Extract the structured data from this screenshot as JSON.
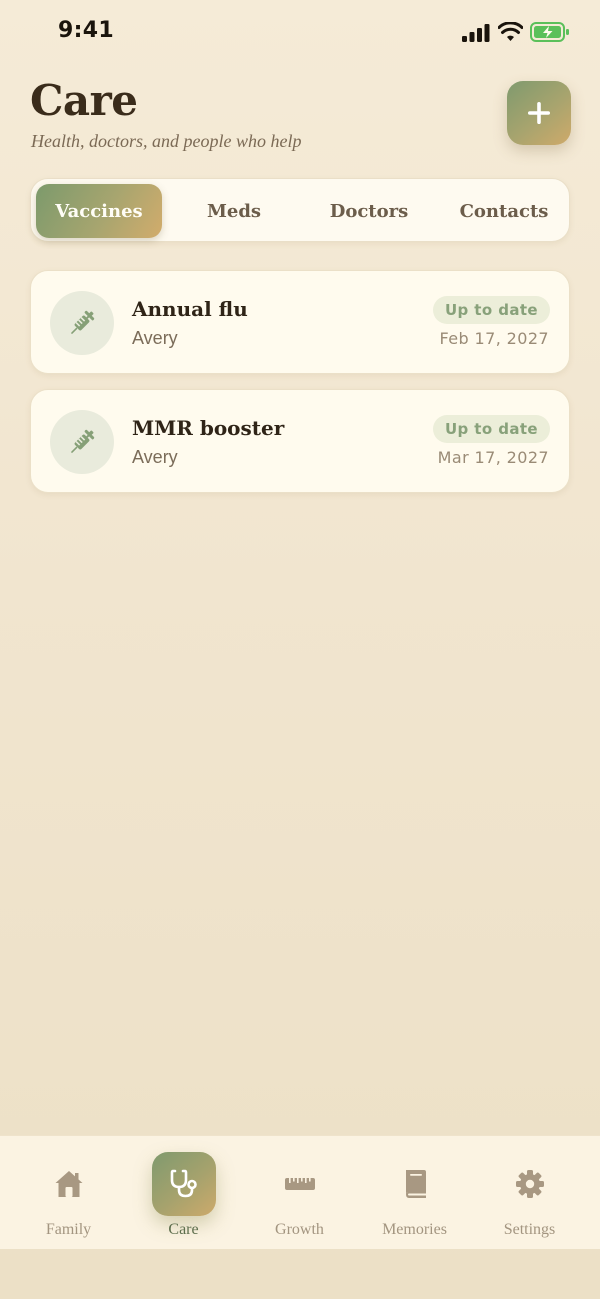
{
  "status_bar": {
    "time": "9:41"
  },
  "header": {
    "title": "Care",
    "subtitle": "Health, doctors, and people who help"
  },
  "segments": [
    {
      "label": "Vaccines",
      "active": true
    },
    {
      "label": "Meds",
      "active": false
    },
    {
      "label": "Doctors",
      "active": false
    },
    {
      "label": "Contacts",
      "active": false
    }
  ],
  "vaccines": [
    {
      "name": "Annual flu",
      "person": "Avery",
      "status": "Up to date",
      "date": "Feb 17, 2027",
      "icon": "syringe-icon"
    },
    {
      "name": "MMR booster",
      "person": "Avery",
      "status": "Up to date",
      "date": "Mar 17, 2027",
      "icon": "syringe-icon"
    }
  ],
  "tabbar": [
    {
      "label": "Family",
      "icon": "house-icon",
      "active": false
    },
    {
      "label": "Care",
      "icon": "stethoscope-icon",
      "active": true
    },
    {
      "label": "Growth",
      "icon": "ruler-icon",
      "active": false
    },
    {
      "label": "Memories",
      "icon": "book-icon",
      "active": false
    },
    {
      "label": "Settings",
      "icon": "gear-icon",
      "active": false
    }
  ],
  "colors": {
    "accent_green": "#7f9a6e",
    "accent_gold": "#cfaa6a",
    "badge_text": "#88a17a",
    "background": "#f3e8d3"
  }
}
